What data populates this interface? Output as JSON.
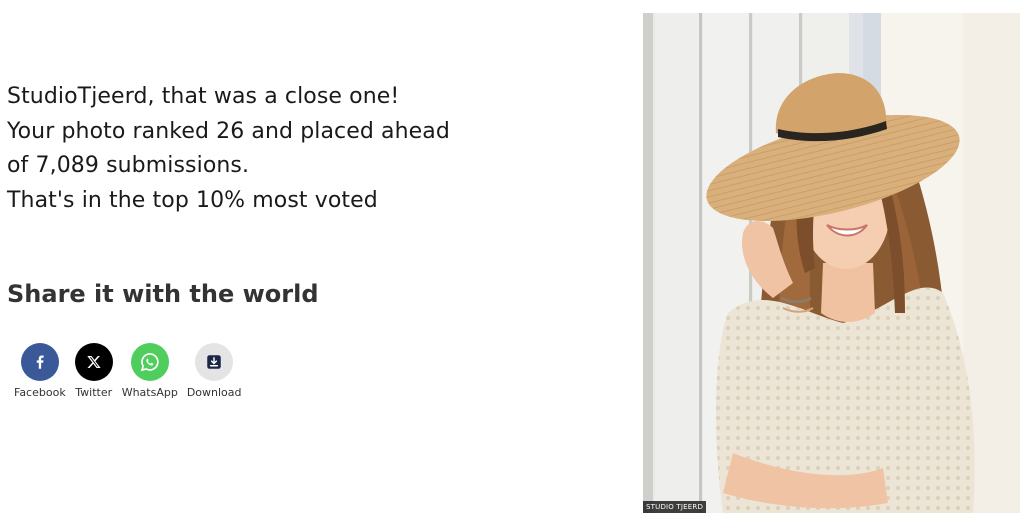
{
  "result": {
    "line1": "StudioTjeerd, that was a close one!",
    "line2": "Your photo ranked 26 and placed ahead",
    "line3": "of 7,089 submissions.",
    "line4": "That's in the top 10% most voted"
  },
  "share": {
    "heading": "Share it with the world",
    "buttons": [
      {
        "label": "Facebook",
        "icon": "facebook-icon",
        "color": "#3b5998"
      },
      {
        "label": "Twitter",
        "icon": "x-icon",
        "color": "#000000"
      },
      {
        "label": "WhatsApp",
        "icon": "whatsapp-icon",
        "color": "#4fce5d"
      },
      {
        "label": "Download",
        "icon": "download-icon",
        "color": "#e4e4e4"
      }
    ]
  },
  "photo": {
    "watermark": "STUDIO TJEERD"
  }
}
